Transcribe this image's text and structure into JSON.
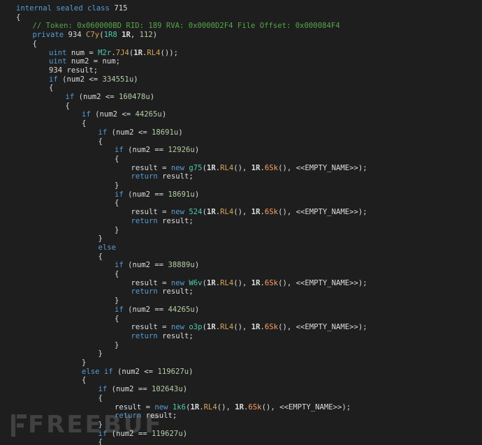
{
  "editor": {
    "lines": [
      {
        "indent": 0,
        "tokens": [
          {
            "t": "internal sealed class ",
            "c": "kw"
          },
          {
            "t": "715",
            "c": "pl"
          }
        ]
      },
      {
        "indent": 0,
        "tokens": [
          {
            "t": "{",
            "c": "pl"
          }
        ]
      },
      {
        "indent": 1,
        "tokens": [
          {
            "t": "// Token: 0x060000BD RID: 189 RVA: 0x0000D2F4 File Offset: 0x000084F4",
            "c": "cm"
          }
        ]
      },
      {
        "indent": 1,
        "tokens": [
          {
            "t": "private ",
            "c": "kw"
          },
          {
            "t": "934 ",
            "c": "pl"
          },
          {
            "t": "C7y",
            "c": "mt"
          },
          {
            "t": "(",
            "c": "pl"
          },
          {
            "t": "1R8 ",
            "c": "ty"
          },
          {
            "t": "1R",
            "c": "id"
          },
          {
            "t": ", ",
            "c": "pl"
          },
          {
            "t": "112",
            "c": "num"
          },
          {
            "t": ")",
            "c": "pl"
          }
        ]
      },
      {
        "indent": 1,
        "tokens": [
          {
            "t": "{",
            "c": "pl"
          }
        ]
      },
      {
        "indent": 2,
        "tokens": [
          {
            "t": "uint ",
            "c": "kw"
          },
          {
            "t": "num = ",
            "c": "pl"
          },
          {
            "t": "M2r",
            "c": "ty"
          },
          {
            "t": ".",
            "c": "pl"
          },
          {
            "t": "7J4",
            "c": "mt"
          },
          {
            "t": "(",
            "c": "pl"
          },
          {
            "t": "1R",
            "c": "id"
          },
          {
            "t": ".",
            "c": "pl"
          },
          {
            "t": "RL4",
            "c": "mt"
          },
          {
            "t": "());",
            "c": "pl"
          }
        ]
      },
      {
        "indent": 2,
        "tokens": [
          {
            "t": "uint ",
            "c": "kw"
          },
          {
            "t": "num2 = num;",
            "c": "pl"
          }
        ]
      },
      {
        "indent": 2,
        "tokens": [
          {
            "t": "934 result;",
            "c": "pl"
          }
        ]
      },
      {
        "indent": 2,
        "tokens": [
          {
            "t": "if ",
            "c": "kw"
          },
          {
            "t": "(num2 <= ",
            "c": "pl"
          },
          {
            "t": "334551u",
            "c": "num"
          },
          {
            "t": ")",
            "c": "pl"
          }
        ]
      },
      {
        "indent": 2,
        "tokens": [
          {
            "t": "{",
            "c": "pl"
          }
        ]
      },
      {
        "indent": 3,
        "tokens": [
          {
            "t": "if ",
            "c": "kw"
          },
          {
            "t": "(num2 <= ",
            "c": "pl"
          },
          {
            "t": "160478u",
            "c": "num"
          },
          {
            "t": ")",
            "c": "pl"
          }
        ]
      },
      {
        "indent": 3,
        "tokens": [
          {
            "t": "{",
            "c": "pl"
          }
        ]
      },
      {
        "indent": 4,
        "tokens": [
          {
            "t": "if ",
            "c": "kw"
          },
          {
            "t": "(num2 <= ",
            "c": "pl"
          },
          {
            "t": "44265u",
            "c": "num"
          },
          {
            "t": ")",
            "c": "pl"
          }
        ]
      },
      {
        "indent": 4,
        "tokens": [
          {
            "t": "{",
            "c": "pl"
          }
        ]
      },
      {
        "indent": 5,
        "tokens": [
          {
            "t": "if ",
            "c": "kw"
          },
          {
            "t": "(num2 <= ",
            "c": "pl"
          },
          {
            "t": "18691u",
            "c": "num"
          },
          {
            "t": ")",
            "c": "pl"
          }
        ]
      },
      {
        "indent": 5,
        "tokens": [
          {
            "t": "{",
            "c": "pl"
          }
        ]
      },
      {
        "indent": 6,
        "tokens": [
          {
            "t": "if ",
            "c": "kw"
          },
          {
            "t": "(num2 == ",
            "c": "pl"
          },
          {
            "t": "12926u",
            "c": "num"
          },
          {
            "t": ")",
            "c": "pl"
          }
        ]
      },
      {
        "indent": 6,
        "tokens": [
          {
            "t": "{",
            "c": "pl"
          }
        ]
      },
      {
        "indent": 7,
        "tokens": [
          {
            "t": "result = ",
            "c": "pl"
          },
          {
            "t": "new ",
            "c": "kw"
          },
          {
            "t": "g75",
            "c": "ty"
          },
          {
            "t": "(",
            "c": "pl"
          },
          {
            "t": "1R",
            "c": "id"
          },
          {
            "t": ".",
            "c": "pl"
          },
          {
            "t": "RL4",
            "c": "mt"
          },
          {
            "t": "(), ",
            "c": "pl"
          },
          {
            "t": "1R",
            "c": "id"
          },
          {
            "t": ".",
            "c": "pl"
          },
          {
            "t": "6Sk",
            "c": "prop"
          },
          {
            "t": "(), <<EMPTY_NAME>>);",
            "c": "pl"
          }
        ]
      },
      {
        "indent": 7,
        "tokens": [
          {
            "t": "return ",
            "c": "kw"
          },
          {
            "t": "result;",
            "c": "pl"
          }
        ]
      },
      {
        "indent": 6,
        "tokens": [
          {
            "t": "}",
            "c": "pl"
          }
        ]
      },
      {
        "indent": 6,
        "tokens": [
          {
            "t": "if ",
            "c": "kw"
          },
          {
            "t": "(num2 == ",
            "c": "pl"
          },
          {
            "t": "18691u",
            "c": "num"
          },
          {
            "t": ")",
            "c": "pl"
          }
        ]
      },
      {
        "indent": 6,
        "tokens": [
          {
            "t": "{",
            "c": "pl"
          }
        ]
      },
      {
        "indent": 7,
        "tokens": [
          {
            "t": "result = ",
            "c": "pl"
          },
          {
            "t": "new ",
            "c": "kw"
          },
          {
            "t": "524",
            "c": "ty"
          },
          {
            "t": "(",
            "c": "pl"
          },
          {
            "t": "1R",
            "c": "id"
          },
          {
            "t": ".",
            "c": "pl"
          },
          {
            "t": "RL4",
            "c": "mt"
          },
          {
            "t": "(), ",
            "c": "pl"
          },
          {
            "t": "1R",
            "c": "id"
          },
          {
            "t": ".",
            "c": "pl"
          },
          {
            "t": "6Sk",
            "c": "prop"
          },
          {
            "t": "(), <<EMPTY_NAME>>);",
            "c": "pl"
          }
        ]
      },
      {
        "indent": 7,
        "tokens": [
          {
            "t": "return ",
            "c": "kw"
          },
          {
            "t": "result;",
            "c": "pl"
          }
        ]
      },
      {
        "indent": 6,
        "tokens": [
          {
            "t": "}",
            "c": "pl"
          }
        ]
      },
      {
        "indent": 5,
        "tokens": [
          {
            "t": "}",
            "c": "pl"
          }
        ]
      },
      {
        "indent": 5,
        "tokens": [
          {
            "t": "else",
            "c": "kw"
          }
        ]
      },
      {
        "indent": 5,
        "tokens": [
          {
            "t": "{",
            "c": "pl"
          }
        ]
      },
      {
        "indent": 6,
        "tokens": [
          {
            "t": "if ",
            "c": "kw"
          },
          {
            "t": "(num2 == ",
            "c": "pl"
          },
          {
            "t": "38889u",
            "c": "num"
          },
          {
            "t": ")",
            "c": "pl"
          }
        ]
      },
      {
        "indent": 6,
        "tokens": [
          {
            "t": "{",
            "c": "pl"
          }
        ]
      },
      {
        "indent": 7,
        "tokens": [
          {
            "t": "result = ",
            "c": "pl"
          },
          {
            "t": "new ",
            "c": "kw"
          },
          {
            "t": "W6v",
            "c": "ty"
          },
          {
            "t": "(",
            "c": "pl"
          },
          {
            "t": "1R",
            "c": "id"
          },
          {
            "t": ".",
            "c": "pl"
          },
          {
            "t": "RL4",
            "c": "mt"
          },
          {
            "t": "(), ",
            "c": "pl"
          },
          {
            "t": "1R",
            "c": "id"
          },
          {
            "t": ".",
            "c": "pl"
          },
          {
            "t": "6Sk",
            "c": "prop"
          },
          {
            "t": "(), <<EMPTY_NAME>>);",
            "c": "pl"
          }
        ]
      },
      {
        "indent": 7,
        "tokens": [
          {
            "t": "return ",
            "c": "kw"
          },
          {
            "t": "result;",
            "c": "pl"
          }
        ]
      },
      {
        "indent": 6,
        "tokens": [
          {
            "t": "}",
            "c": "pl"
          }
        ]
      },
      {
        "indent": 6,
        "tokens": [
          {
            "t": "if ",
            "c": "kw"
          },
          {
            "t": "(num2 == ",
            "c": "pl"
          },
          {
            "t": "44265u",
            "c": "num"
          },
          {
            "t": ")",
            "c": "pl"
          }
        ]
      },
      {
        "indent": 6,
        "tokens": [
          {
            "t": "{",
            "c": "pl"
          }
        ]
      },
      {
        "indent": 7,
        "tokens": [
          {
            "t": "result = ",
            "c": "pl"
          },
          {
            "t": "new ",
            "c": "kw"
          },
          {
            "t": "o3p",
            "c": "ty"
          },
          {
            "t": "(",
            "c": "pl"
          },
          {
            "t": "1R",
            "c": "id"
          },
          {
            "t": ".",
            "c": "pl"
          },
          {
            "t": "RL4",
            "c": "mt"
          },
          {
            "t": "(), ",
            "c": "pl"
          },
          {
            "t": "1R",
            "c": "id"
          },
          {
            "t": ".",
            "c": "pl"
          },
          {
            "t": "6Sk",
            "c": "prop"
          },
          {
            "t": "(), <<EMPTY_NAME>>);",
            "c": "pl"
          }
        ]
      },
      {
        "indent": 7,
        "tokens": [
          {
            "t": "return ",
            "c": "kw"
          },
          {
            "t": "result;",
            "c": "pl"
          }
        ]
      },
      {
        "indent": 6,
        "tokens": [
          {
            "t": "}",
            "c": "pl"
          }
        ]
      },
      {
        "indent": 5,
        "tokens": [
          {
            "t": "}",
            "c": "pl"
          }
        ]
      },
      {
        "indent": 4,
        "tokens": [
          {
            "t": "}",
            "c": "pl"
          }
        ]
      },
      {
        "indent": 4,
        "tokens": [
          {
            "t": "else if ",
            "c": "kw"
          },
          {
            "t": "(num2 <= ",
            "c": "pl"
          },
          {
            "t": "119627u",
            "c": "num"
          },
          {
            "t": ")",
            "c": "pl"
          }
        ]
      },
      {
        "indent": 4,
        "tokens": [
          {
            "t": "{",
            "c": "pl"
          }
        ]
      },
      {
        "indent": 5,
        "tokens": [
          {
            "t": "if ",
            "c": "kw"
          },
          {
            "t": "(num2 == ",
            "c": "pl"
          },
          {
            "t": "102643u",
            "c": "num"
          },
          {
            "t": ")",
            "c": "pl"
          }
        ]
      },
      {
        "indent": 5,
        "tokens": [
          {
            "t": "{",
            "c": "pl"
          }
        ]
      },
      {
        "indent": 6,
        "tokens": [
          {
            "t": "result = ",
            "c": "pl"
          },
          {
            "t": "new ",
            "c": "kw"
          },
          {
            "t": "1k6",
            "c": "ty"
          },
          {
            "t": "(",
            "c": "pl"
          },
          {
            "t": "1R",
            "c": "id"
          },
          {
            "t": ".",
            "c": "pl"
          },
          {
            "t": "RL4",
            "c": "mt"
          },
          {
            "t": "(), ",
            "c": "pl"
          },
          {
            "t": "1R",
            "c": "id"
          },
          {
            "t": ".",
            "c": "pl"
          },
          {
            "t": "6Sk",
            "c": "prop"
          },
          {
            "t": "(), <<EMPTY_NAME>>);",
            "c": "pl"
          }
        ]
      },
      {
        "indent": 6,
        "tokens": [
          {
            "t": "return ",
            "c": "kw"
          },
          {
            "t": "result;",
            "c": "pl"
          }
        ]
      },
      {
        "indent": 5,
        "tokens": [
          {
            "t": "}",
            "c": "pl"
          }
        ]
      },
      {
        "indent": 5,
        "tokens": [
          {
            "t": "if ",
            "c": "kw"
          },
          {
            "t": "(num2 == ",
            "c": "pl"
          },
          {
            "t": "119627u",
            "c": "num"
          },
          {
            "t": ")",
            "c": "pl"
          }
        ]
      },
      {
        "indent": 5,
        "tokens": [
          {
            "t": "{",
            "c": "pl"
          }
        ]
      }
    ]
  },
  "colors": {
    "background": "#1e1e1e",
    "keyword": "#569cd6",
    "comment": "#57a64a",
    "method": "#d7a559",
    "type": "#4ec9b0",
    "number": "#b5cea8",
    "property": "#ffa066",
    "plain": "#dcdcdc"
  },
  "watermark": {
    "text": "FREEBUF",
    "icon": "freebuf-logo-icon"
  }
}
